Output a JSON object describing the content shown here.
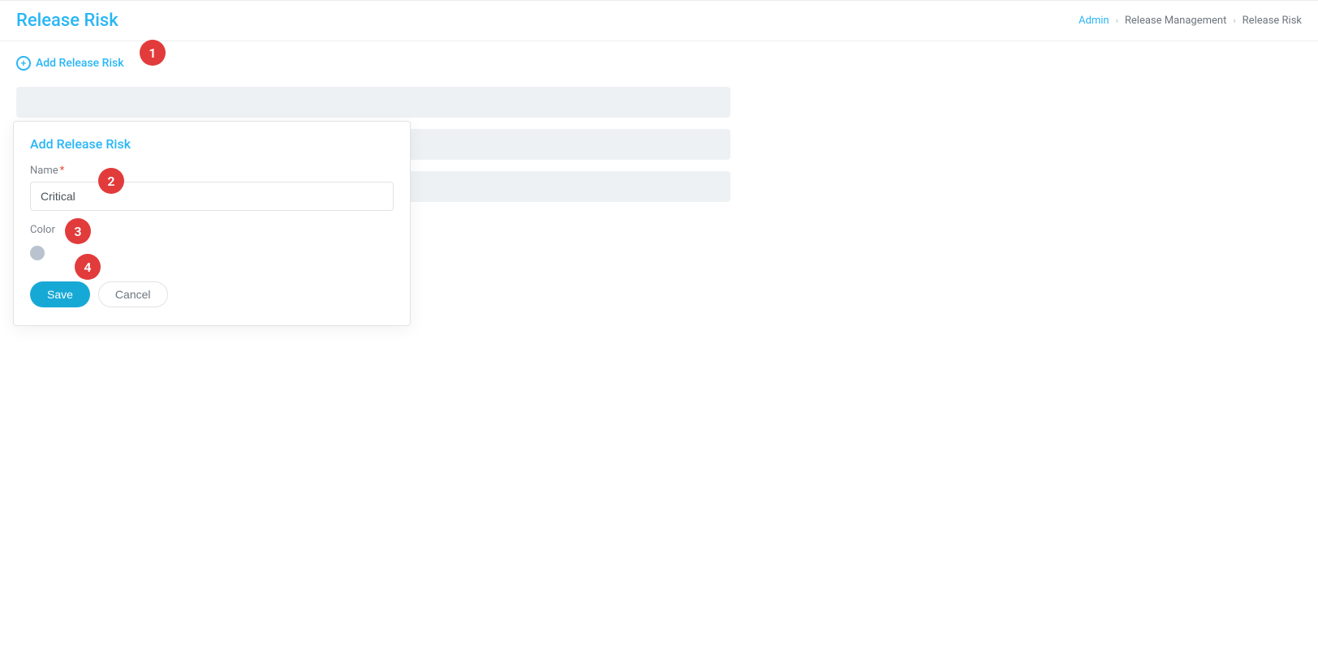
{
  "page": {
    "title": "Release Risk"
  },
  "breadcrumb": {
    "admin": "Admin",
    "release_management": "Release Management",
    "release_risk": "Release Risk"
  },
  "toolbar": {
    "add_link": "Add Release Risk"
  },
  "popover": {
    "title": "Add Release Risk",
    "name_label": "Name",
    "name_value": "Critical",
    "color_label": "Color",
    "color_value": "#b9c3cf",
    "save_label": "Save",
    "cancel_label": "Cancel"
  },
  "callouts": {
    "c1": "1",
    "c2": "2",
    "c3": "3",
    "c4": "4"
  }
}
